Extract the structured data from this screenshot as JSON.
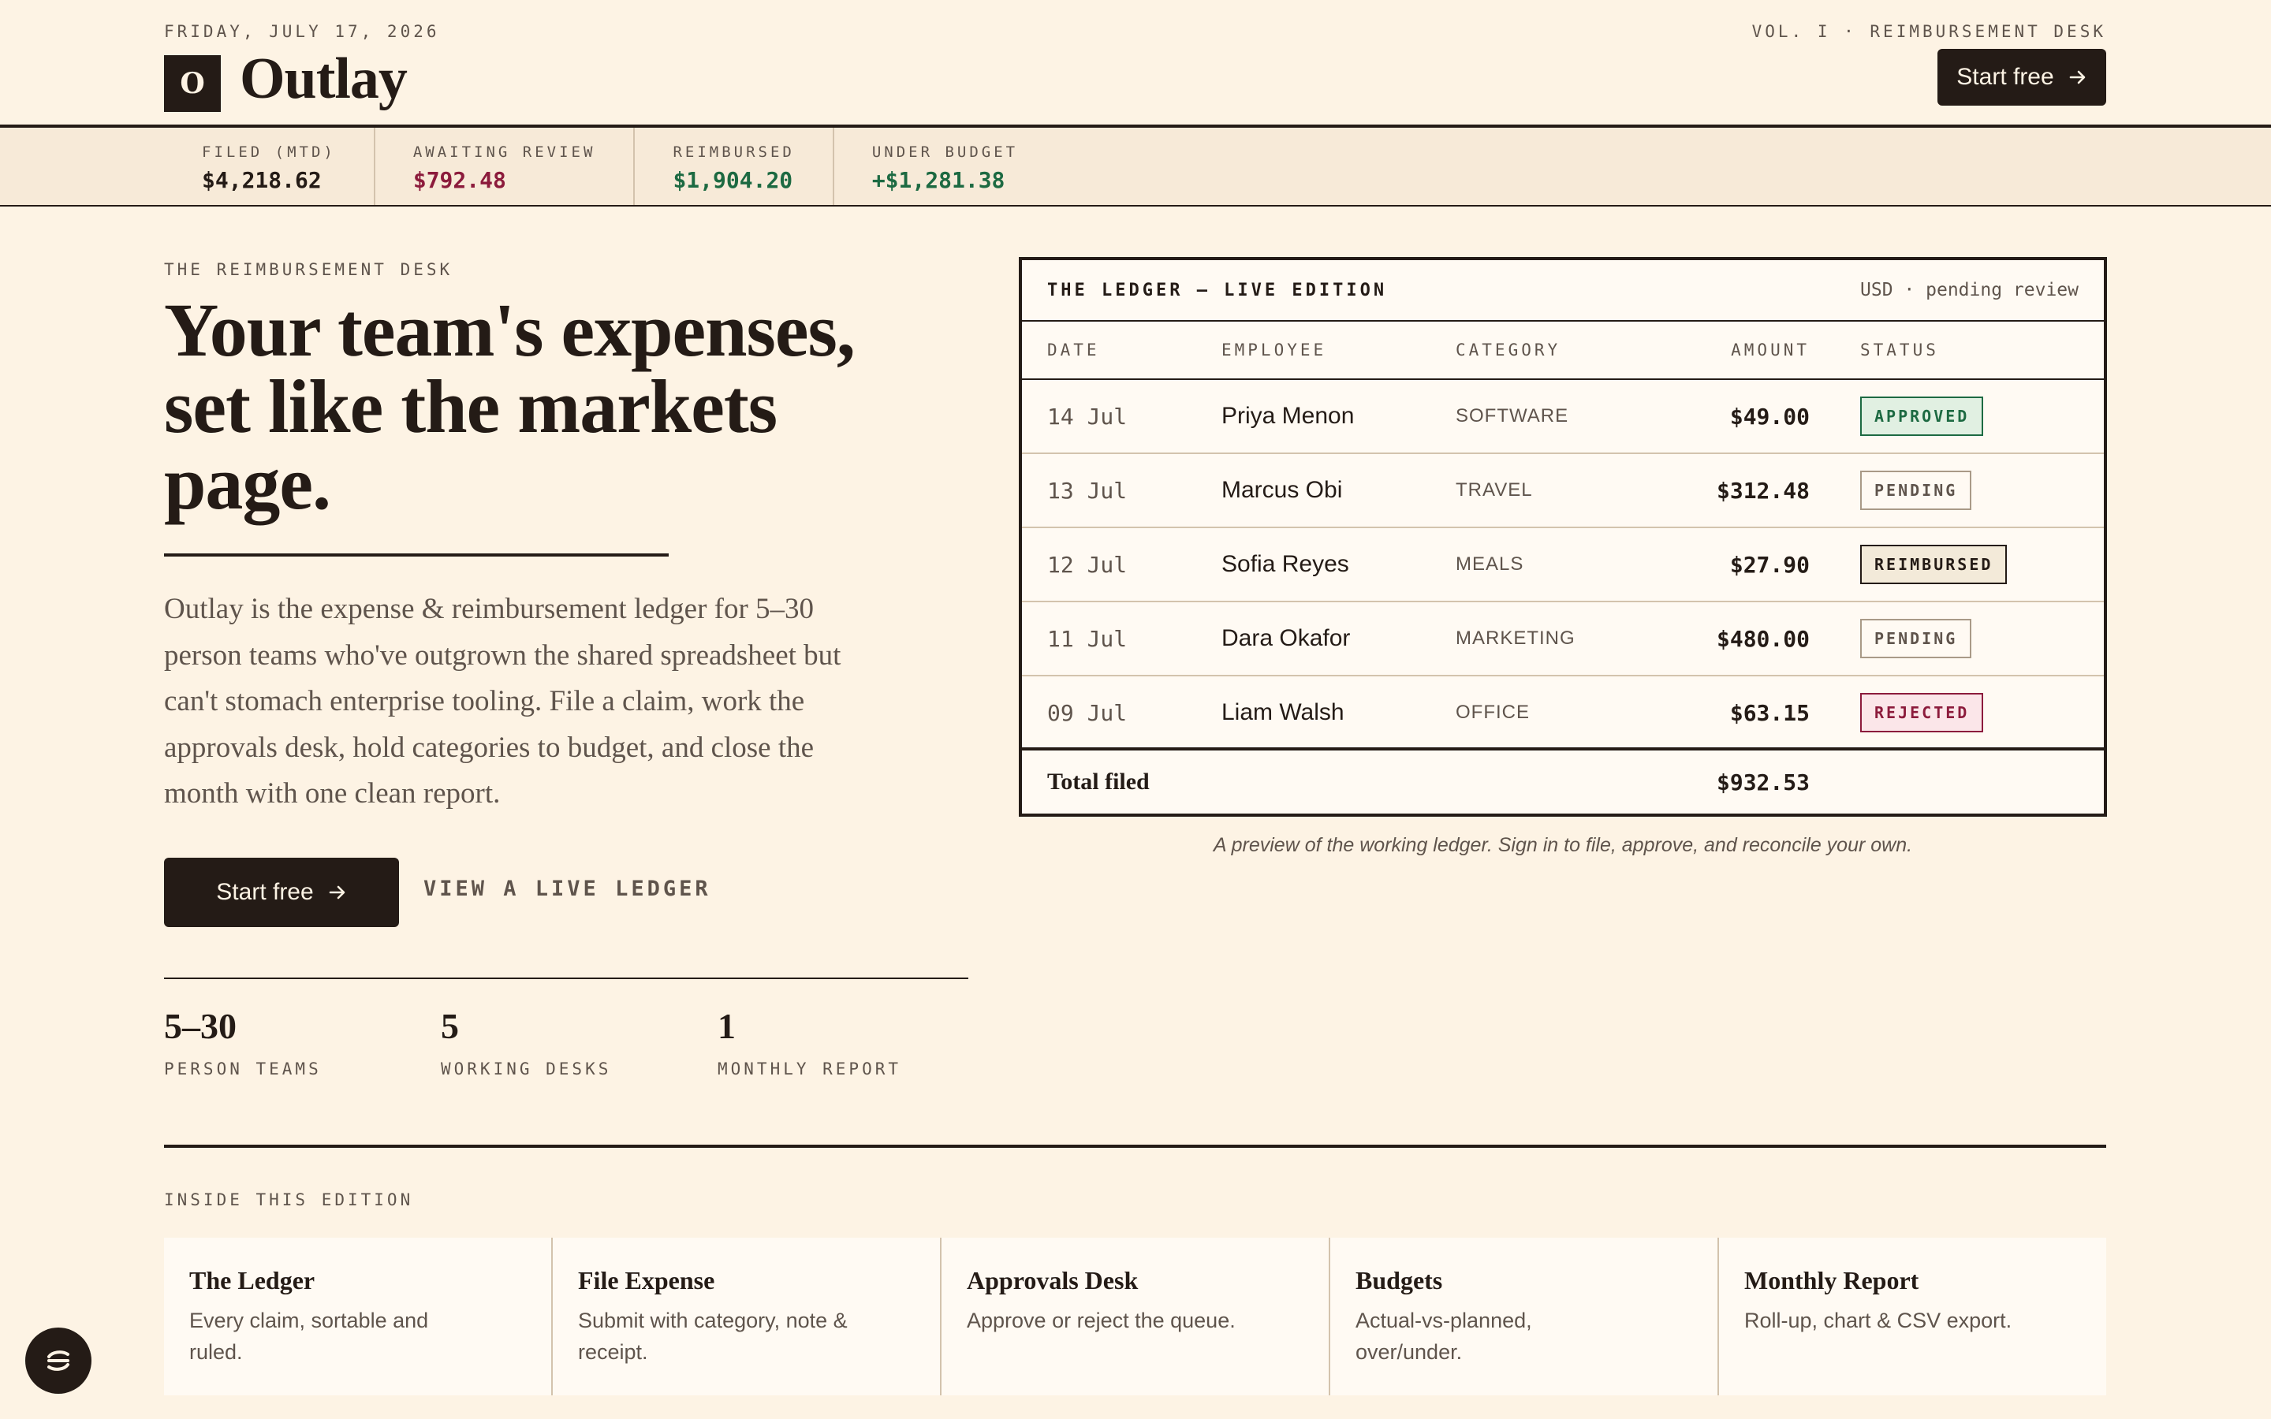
{
  "header": {
    "dateline": "FRIDAY, JULY 17, 2026",
    "logo_mark": "O",
    "brand": "Outlay",
    "volume": "VOL. I · REIMBURSEMENT DESK",
    "cta_label": "Start free",
    "cta_icon": "arrow-right-icon"
  },
  "ticker": [
    {
      "label": "FILED (MTD)",
      "value": "$4,218.62",
      "tone": "neutral"
    },
    {
      "label": "AWAITING REVIEW",
      "value": "$792.48",
      "tone": "red"
    },
    {
      "label": "REIMBURSED",
      "value": "$1,904.20",
      "tone": "green"
    },
    {
      "label": "UNDER BUDGET",
      "value": "+$1,281.38",
      "tone": "green"
    }
  ],
  "hero": {
    "kicker": "THE REIMBURSEMENT DESK",
    "headline": "Your team's expenses, set like the markets page.",
    "lede": "Outlay is the expense & reimbursement ledger for 5–30 person teams who've outgrown the shared spreadsheet but can't stomach enterprise tooling. File a claim, work the approvals desk, hold categories to budget, and close the month with one clean report.",
    "cta_label": "Start free",
    "secondary_link": "VIEW A LIVE LEDGER"
  },
  "stats": [
    {
      "value": "5–30",
      "label": "PERSON TEAMS"
    },
    {
      "value": "5",
      "label": "WORKING DESKS"
    },
    {
      "value": "1",
      "label": "MONTHLY REPORT"
    }
  ],
  "ledger": {
    "title": "THE LEDGER — LIVE EDITION",
    "meta": "USD · pending review",
    "columns": {
      "date": "DATE",
      "employee": "EMPLOYEE",
      "category": "CATEGORY",
      "amount": "AMOUNT",
      "status": "STATUS"
    },
    "rows": [
      {
        "date": "14 Jul",
        "employee": "Priya Menon",
        "category": "SOFTWARE",
        "amount": "$49.00",
        "status": "APPROVED"
      },
      {
        "date": "13 Jul",
        "employee": "Marcus Obi",
        "category": "TRAVEL",
        "amount": "$312.48",
        "status": "PENDING"
      },
      {
        "date": "12 Jul",
        "employee": "Sofia Reyes",
        "category": "MEALS",
        "amount": "$27.90",
        "status": "REIMBURSED"
      },
      {
        "date": "11 Jul",
        "employee": "Dara Okafor",
        "category": "MARKETING",
        "amount": "$480.00",
        "status": "PENDING"
      },
      {
        "date": "09 Jul",
        "employee": "Liam Walsh",
        "category": "OFFICE",
        "amount": "$63.15",
        "status": "REJECTED"
      }
    ],
    "total_label": "Total filed",
    "total_amount": "$932.53",
    "caption": "A preview of the working ledger. Sign in to file, approve, and reconcile your own."
  },
  "inside": {
    "label": "INSIDE THIS EDITION",
    "cards": [
      {
        "title": "The Ledger",
        "desc": "Every claim, sortable and ruled."
      },
      {
        "title": "File Expense",
        "desc": "Submit with category, note & receipt."
      },
      {
        "title": "Approvals Desk",
        "desc": "Approve or reject the queue."
      },
      {
        "title": "Budgets",
        "desc": "Actual-vs-planned, over/under."
      },
      {
        "title": "Monthly Report",
        "desc": "Roll-up, chart & CSV export."
      }
    ]
  },
  "floating_button_icon": "chat-icon",
  "colors": {
    "background": "#fdf3e4",
    "ink": "#241b16",
    "muted": "#5f544c",
    "positive": "#1d6a42",
    "negative": "#8c1b3c"
  }
}
